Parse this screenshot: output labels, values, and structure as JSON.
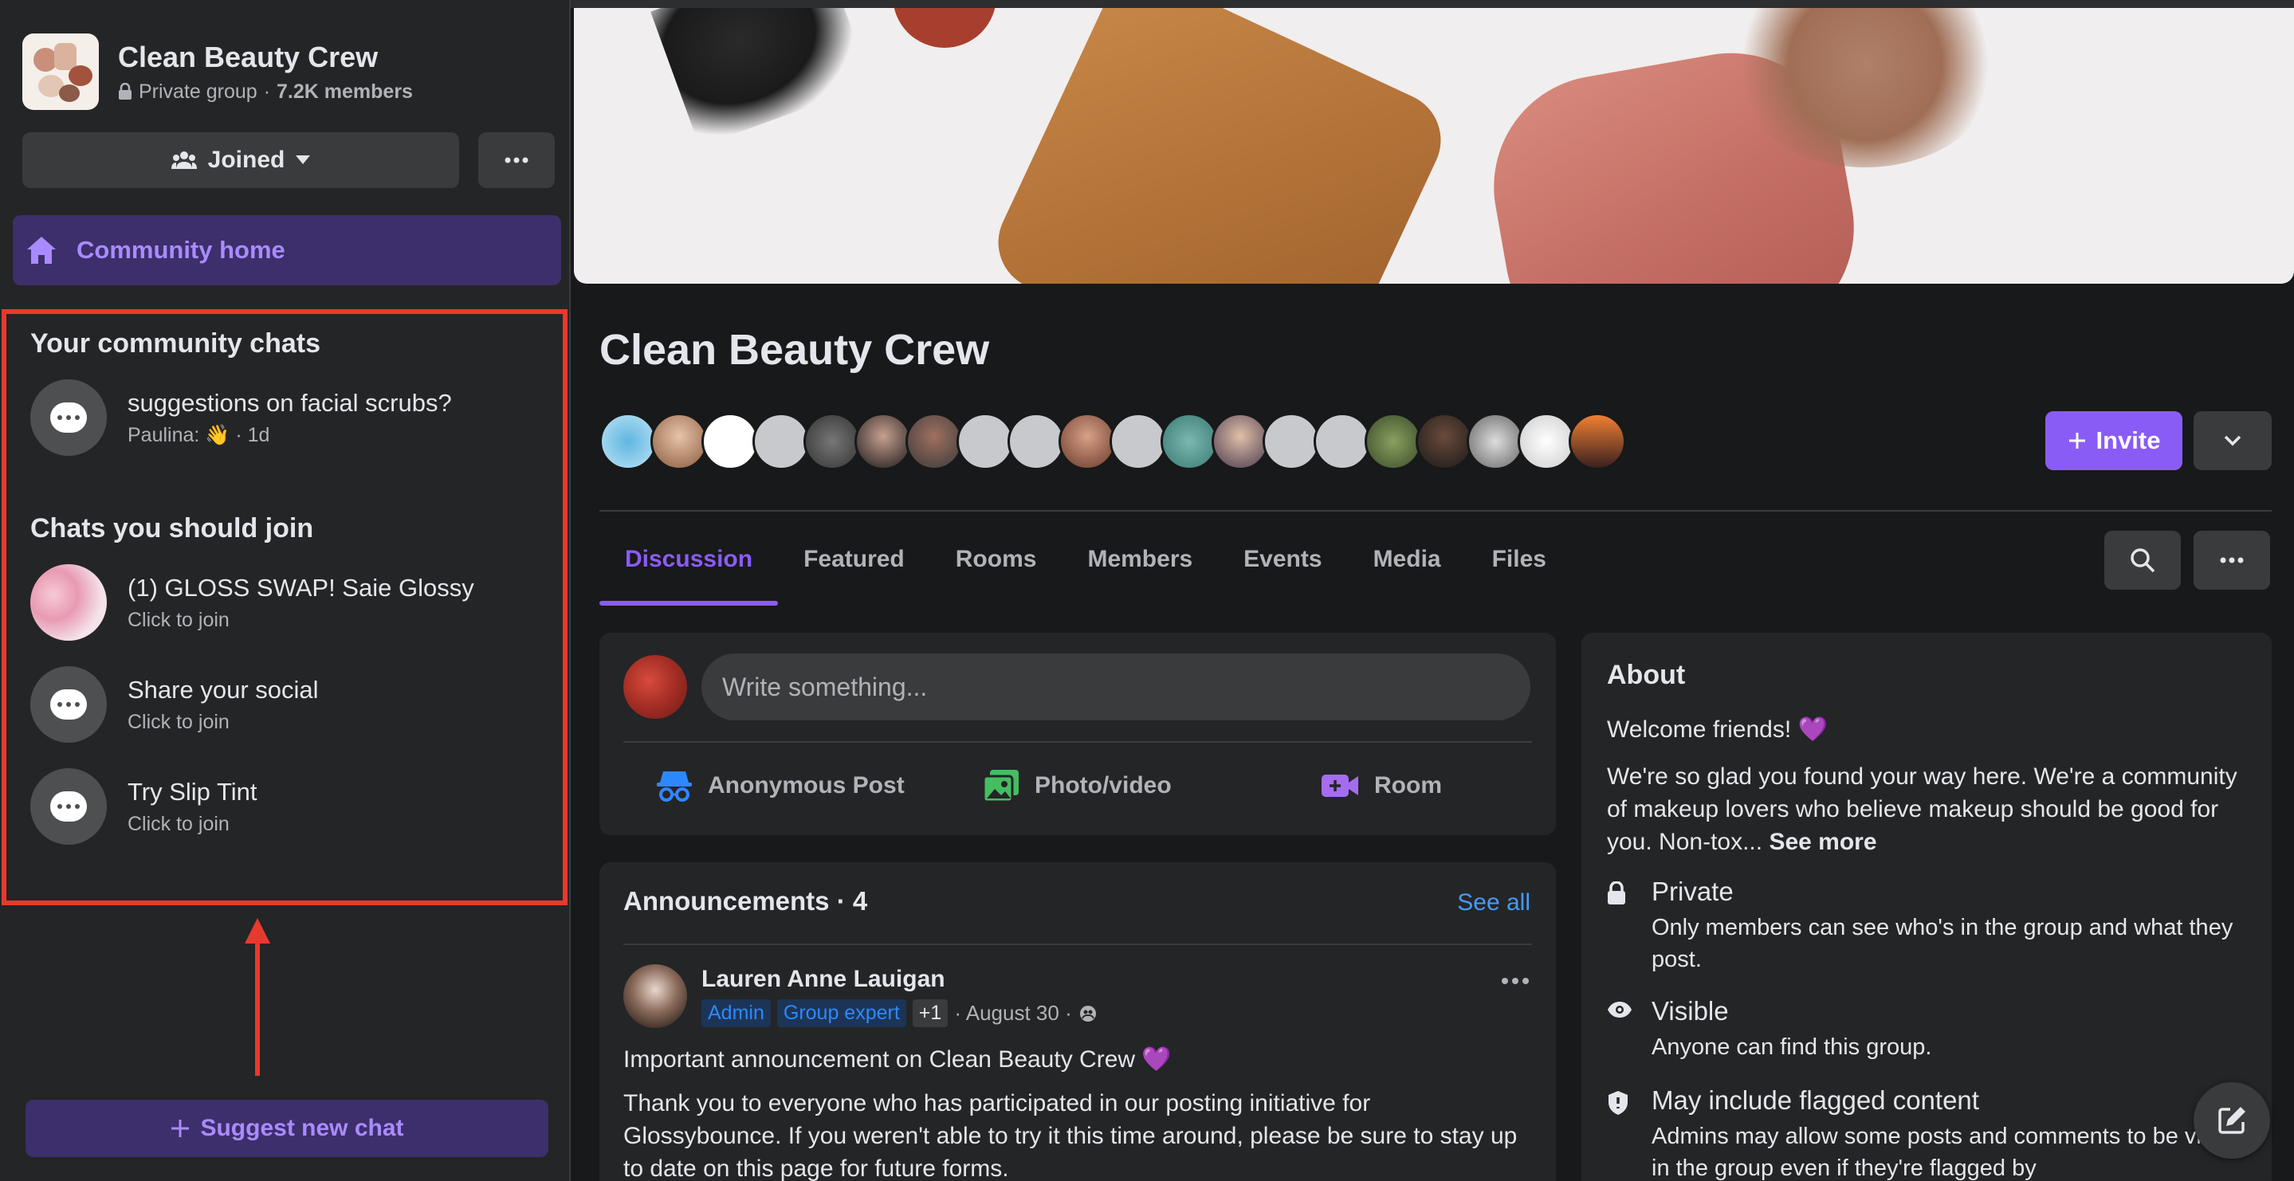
{
  "group": {
    "name": "Clean Beauty Crew",
    "privacy": "Private group",
    "members": "7.2K members",
    "separator": "·"
  },
  "sidebar": {
    "joined_label": "Joined",
    "community_home_label": "Community home",
    "your_chats_title": "Your community chats",
    "your_chats": [
      {
        "name": "suggestions on facial scrubs?",
        "meta": "Paulina: 👋 · 1d"
      }
    ],
    "join_chats_title": "Chats you should join",
    "join_chats": [
      {
        "name": "(1) GLOSS SWAP! Saie Glossy",
        "meta": "Click to join"
      },
      {
        "name": "Share your social",
        "meta": "Click to join"
      },
      {
        "name": "Try Slip Tint",
        "meta": "Click to join"
      }
    ],
    "suggest_label": "Suggest new chat"
  },
  "main": {
    "title": "Clean Beauty Crew",
    "invite_label": "Invite",
    "tabs": [
      {
        "label": "Discussion"
      },
      {
        "label": "Featured"
      },
      {
        "label": "Rooms"
      },
      {
        "label": "Members"
      },
      {
        "label": "Events"
      },
      {
        "label": "Media"
      },
      {
        "label": "Files"
      }
    ],
    "composer": {
      "placeholder": "Write something...",
      "actions": [
        {
          "label": "Anonymous Post",
          "icon": "incognito-icon"
        },
        {
          "label": "Photo/video",
          "icon": "photo-icon"
        },
        {
          "label": "Room",
          "icon": "video-room-icon"
        }
      ]
    },
    "announcements": {
      "title": "Announcements · 4",
      "see_all": "See all",
      "post": {
        "author": "Lauren Anne Lauigan",
        "badges": [
          "Admin",
          "Group expert",
          "+1"
        ],
        "date": "· August 30 ·",
        "headline": "Important announcement on Clean Beauty Crew 💜",
        "body": "Thank you to everyone who has participated in our posting initiative for Glossybounce. If you weren't able to try it this time around, please be sure to stay up to date on this page for future forms."
      }
    },
    "about": {
      "title": "About",
      "welcome": "Welcome friends! 💜",
      "desc": "We're so glad you found your way here. We're a community of makeup lovers who believe makeup should be good for you. Non-tox...",
      "see_more": "See more",
      "items": [
        {
          "title": "Private",
          "desc": "Only members can see who's in the group and what they post.",
          "icon": "lock-icon"
        },
        {
          "title": "Visible",
          "desc": "Anyone can find this group.",
          "icon": "eye-icon"
        },
        {
          "title": "May include flagged content",
          "desc": "Admins may allow some posts and comments to be visible in the group even if they're flagged by",
          "icon": "shield-icon"
        }
      ]
    }
  },
  "colors": {
    "accent": "#8a5cf6",
    "annotation": "#e8392d",
    "link": "#4599ff"
  }
}
